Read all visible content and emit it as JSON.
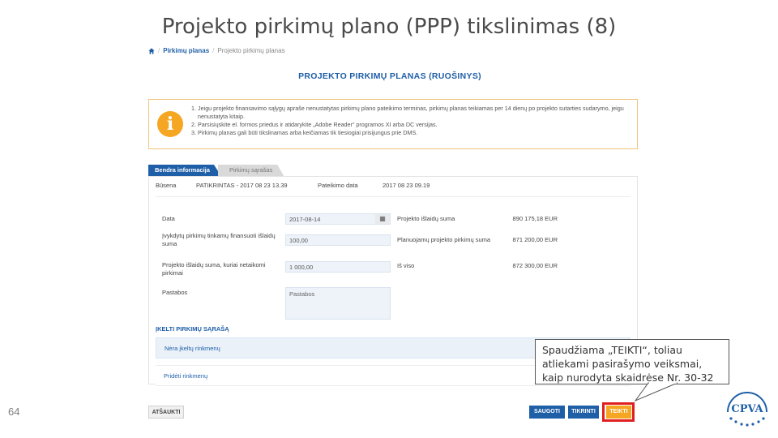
{
  "slide": {
    "title": "Projekto pirkimų plano (PPP) tikslinimas (8)",
    "number": "64"
  },
  "breadcrumb": {
    "items": [
      "Pirkimų planas",
      "Projekto pirkimų planas"
    ],
    "separator": "/"
  },
  "page": {
    "heading": "PROJEKTO PIRKIMŲ PLANAS (RUOŠINYS)"
  },
  "info": {
    "items": [
      "Jeigu projekto finansavimo sąlygų apraše nenustatytas pirkimų plano pateikimo terminas, pirkimų planas teikiamas per 14 dienų po projekto sutarties sudarymo, jeigu nenustatyta kitaip.",
      "Parsisiųskite el. formos priedus ir atidarykite „Adobe Reader“ programos XI arba DC versijas.",
      "Pirkimų planas gali būti tikslinamas arba keičiamas tik tiesiogiai prisijungus prie DMS."
    ]
  },
  "tabs": [
    {
      "label": "Bendra informacija",
      "active": true
    },
    {
      "label": "Pirkimų sąrašas",
      "active": false
    }
  ],
  "form": {
    "status_label": "Būsena",
    "status_value": "PATIKRINTAS - 2017 08 23 13.39",
    "submitted_label": "Pateikimo data",
    "submitted_value": "2017 08 23 09.19",
    "date_label": "Data",
    "date_value": "2017-08-14",
    "contract_amount_label": "Įvykdytų pirkimų tinkamų finansuoti išlaidų suma",
    "contract_amount_value": "100,00",
    "project_costs_label": "Projekto išlaidų suma, kuriai netaikomi pirkimai",
    "project_costs_value": "1 000,00",
    "notes_label": "Pastabos",
    "notes_placeholder": "Pastabos",
    "right": [
      {
        "label": "Projekto išlaidų suma",
        "value": "890 175,18 EUR"
      },
      {
        "label": "Planuojamų projekto pirkimų suma",
        "value": "871 200,00 EUR"
      },
      {
        "label": "Iš viso",
        "value": "872 300,00 EUR"
      }
    ]
  },
  "upload": {
    "title": "ĮKELTI PIRKIMŲ SĄRAŠĄ",
    "row1": "Nėra įkeltų rinkmenų",
    "row2": "Pridėti rinkmenų"
  },
  "buttons": {
    "back": "ATŠAUKTI",
    "save": "SAUGOTI",
    "check": "TIKRINTI",
    "submit": "TEIKTI"
  },
  "callout": {
    "text": "Spaudžiama „TEIKTI“, toliau atliekami pasirašymo veiksmai, kaip nurodyta skaidrėse Nr. 30-32"
  },
  "logo": {
    "text": "CPVA"
  },
  "colors": {
    "primary": "#1f5fa8",
    "accent": "#f5a623",
    "highlight": "#e02020"
  }
}
